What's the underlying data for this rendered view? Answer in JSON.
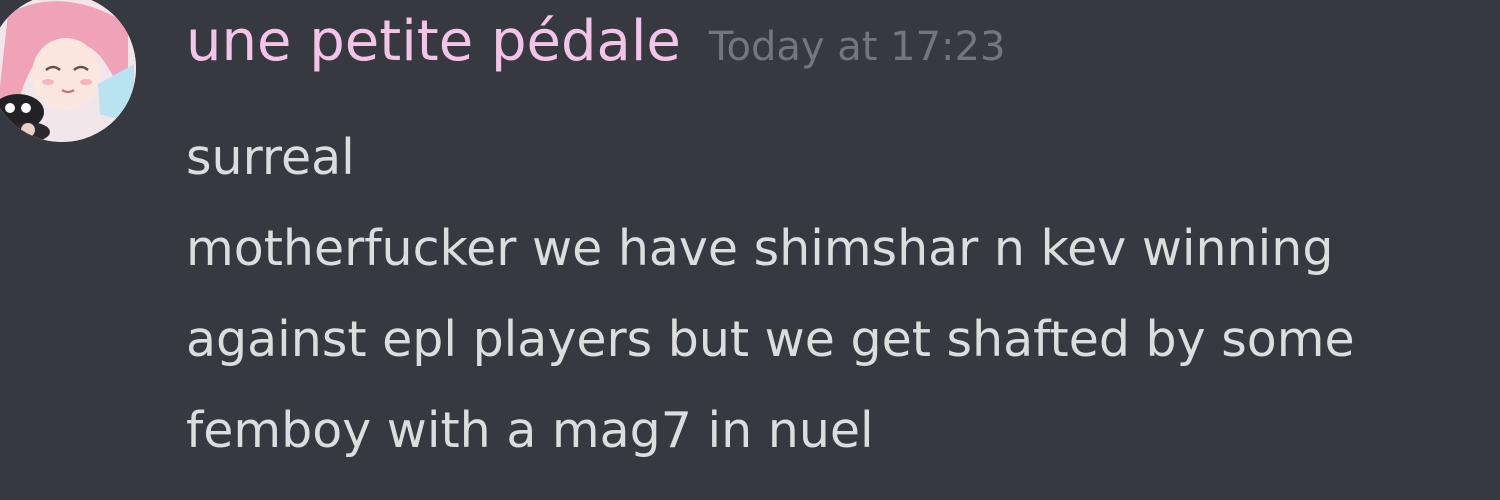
{
  "message": {
    "username": "une petite pédale",
    "timestamp": "Today at 17:23",
    "lines": [
      "surreal",
      "motherfucker we have shimshar n kev winning",
      "against epl players but we get shafted by some",
      "femboy with a mag7 in nuel"
    ]
  },
  "colors": {
    "background": "#36393f",
    "username": "#f2c4e8",
    "timestamp": "#72767d",
    "text": "#dcddde"
  }
}
